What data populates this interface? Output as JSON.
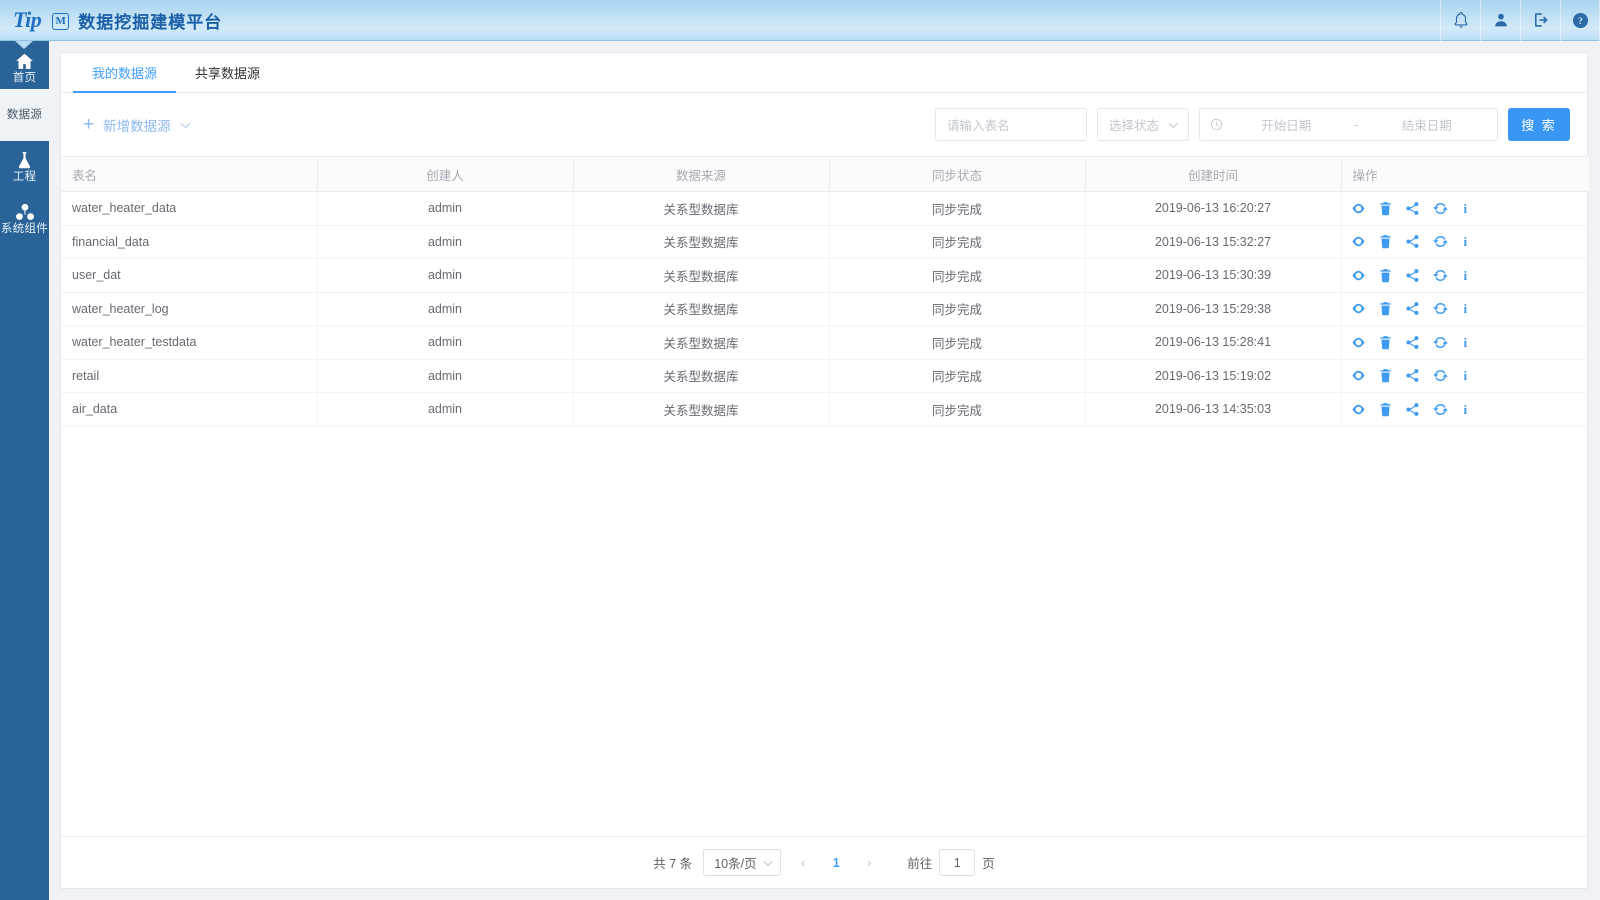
{
  "header": {
    "brand_tip": "Tip",
    "brand_badge": "M",
    "title": "数据挖掘建模平台",
    "icons": [
      {
        "name": "bell-icon",
        "label": "通知"
      },
      {
        "name": "user-icon",
        "label": "用户"
      },
      {
        "name": "logout-icon",
        "label": "退出"
      },
      {
        "name": "help-icon",
        "label": "帮助"
      }
    ],
    "bg_color": "#bfe0f4",
    "brand_color": "#1f6fc4"
  },
  "sidebar": {
    "bg_color": "#2a6398",
    "active_bg_color": "#eef3f7",
    "items": [
      {
        "label": "首页",
        "icon": "home-icon",
        "active": false
      },
      {
        "label": "数据源",
        "icon": "database-icon",
        "active": true
      },
      {
        "label": "工程",
        "icon": "flask-icon",
        "active": false
      },
      {
        "label": "系统组件",
        "icon": "cubes-icon",
        "active": false
      }
    ]
  },
  "tabs": [
    {
      "label": "我的数据源",
      "active": true
    },
    {
      "label": "共享数据源",
      "active": false
    }
  ],
  "toolbar": {
    "add_label": "新增数据源",
    "add_plus": "+",
    "accent_color": "#8cb8ef"
  },
  "filters": {
    "table_name_placeholder": "请输入表名",
    "table_name_value": "",
    "status_placeholder": "选择状态",
    "status_value": "",
    "date_start_placeholder": "开始日期",
    "date_start_value": "",
    "date_separator": "-",
    "date_end_placeholder": "结束日期",
    "date_end_value": "",
    "search_label": "搜 索",
    "search_color": "#3a96f3"
  },
  "table": {
    "columns": [
      {
        "key": "name",
        "label": "表名",
        "align": "left"
      },
      {
        "key": "creator",
        "label": "创建人",
        "align": "center"
      },
      {
        "key": "source",
        "label": "数据来源",
        "align": "center"
      },
      {
        "key": "sync_status",
        "label": "同步状态",
        "align": "center"
      },
      {
        "key": "created_at",
        "label": "创建时间",
        "align": "center"
      },
      {
        "key": "actions",
        "label": "操作",
        "align": "left"
      }
    ],
    "row_actions": [
      {
        "name": "view-icon",
        "title": "查看"
      },
      {
        "name": "delete-icon",
        "title": "删除"
      },
      {
        "name": "share-icon",
        "title": "分享"
      },
      {
        "name": "sync-icon",
        "title": "同步"
      },
      {
        "name": "info-icon",
        "title": "详情",
        "glyph": "i"
      }
    ],
    "rows": [
      {
        "name": "water_heater_data",
        "creator": "admin",
        "source": "关系型数据库",
        "sync_status": "同步完成",
        "created_at": "2019-06-13 16:20:27"
      },
      {
        "name": "financial_data",
        "creator": "admin",
        "source": "关系型数据库",
        "sync_status": "同步完成",
        "created_at": "2019-06-13 15:32:27"
      },
      {
        "name": "user_dat",
        "creator": "admin",
        "source": "关系型数据库",
        "sync_status": "同步完成",
        "created_at": "2019-06-13 15:30:39"
      },
      {
        "name": "water_heater_log",
        "creator": "admin",
        "source": "关系型数据库",
        "sync_status": "同步完成",
        "created_at": "2019-06-13 15:29:38"
      },
      {
        "name": "water_heater_testdata",
        "creator": "admin",
        "source": "关系型数据库",
        "sync_status": "同步完成",
        "created_at": "2019-06-13 15:28:41"
      },
      {
        "name": "retail",
        "creator": "admin",
        "source": "关系型数据库",
        "sync_status": "同步完成",
        "created_at": "2019-06-13 15:19:02"
      },
      {
        "name": "air_data",
        "creator": "admin",
        "source": "关系型数据库",
        "sync_status": "同步完成",
        "created_at": "2019-06-13 14:35:03"
      }
    ]
  },
  "pagination": {
    "total_text": "共 7 条",
    "page_size_label": "10条/页",
    "prev_glyph": "‹",
    "next_glyph": "›",
    "current_page": "1",
    "jump_prefix": "前往",
    "jump_value": "1",
    "jump_suffix": "页",
    "active_color": "#409eff"
  }
}
